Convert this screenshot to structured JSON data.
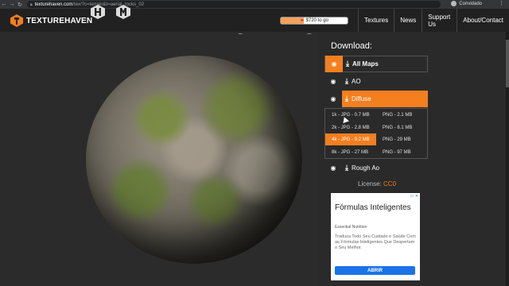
{
  "browser": {
    "back_icon": "back-arrow-icon",
    "forward_icon": "forward-arrow-icon",
    "reload_icon": "reload-icon",
    "url_host": "texturehaven.com",
    "url_path": "/tex/?c=terrain&t=aerial_rocks_02",
    "profile_label": "Convidado",
    "menu_icon": "more-vert-icon"
  },
  "header": {
    "logo_text": "TEXTUREHAVEN",
    "goal_label": "$720 to go",
    "goal_progress": 0.35,
    "nav": [
      "Textures",
      "News",
      "Support Us",
      "About/Contact"
    ]
  },
  "title_fragment": "_ _",
  "download": {
    "title": "Download:",
    "rows": {
      "all_maps": "All Maps",
      "ao": "AO",
      "diffuse": "Diffuse",
      "rough_ao": "Rough Ao"
    },
    "diffuse_options": [
      {
        "jpg": "1k - JPG - 0.7 MB",
        "png": "PNG - 2.1 MB"
      },
      {
        "jpg": "2k - JPG - 2.8 MB",
        "png": "PNG - 8.1 MB"
      },
      {
        "jpg": "4k - JPG - 9.2 MB",
        "png": "PNG - 29 MB"
      },
      {
        "jpg": "8k - JPG - 27 MB",
        "png": "PNG - 97 MB"
      }
    ],
    "highlighted_option_index": 2
  },
  "license": {
    "label": "License:",
    "value": "CC0"
  },
  "ad": {
    "heading": "Fórmulas Inteligentes",
    "advertiser": "Essential Nutrition",
    "body": "Traduza Todo Seu Cuidado e Saúde Com as Fórmulas Inteligentes Que Despertam o Seu Melhor.",
    "button": "ABRIR"
  },
  "colors": {
    "accent": "#f47f1f",
    "header_bg": "#212121",
    "page_bg": "#2a2a2a"
  }
}
